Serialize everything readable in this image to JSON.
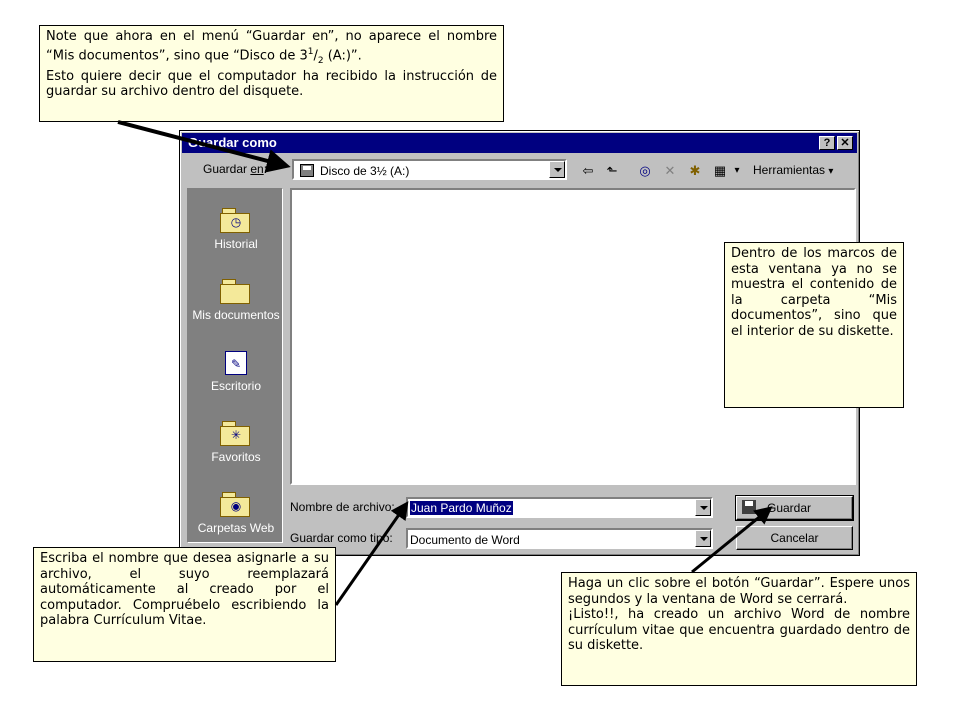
{
  "dialog": {
    "title": "Guardar como",
    "help_button": "?",
    "close_button": "✕",
    "save_in_label_prefix": "Guardar ",
    "save_in_label_accel": "en",
    "save_in_label_suffix": ":",
    "save_in_value": "Disco de 3½ (A:)",
    "toolbar": {
      "back": "⇦",
      "up_folder": "⬑",
      "search_web": "◎",
      "delete": "✕",
      "new_folder": "✱",
      "views": "▦",
      "views_dropdown": "▾",
      "tools_label": "Herramientas",
      "tools_dropdown": "▾"
    },
    "places": [
      {
        "label": "Historial",
        "icon": "history-icon",
        "symbol": "◷"
      },
      {
        "label": "Mis documentos",
        "icon": "my-documents-icon",
        "symbol": ""
      },
      {
        "label": "Escritorio",
        "icon": "desktop-icon",
        "symbol": "✎"
      },
      {
        "label": "Favoritos",
        "icon": "favorites-icon",
        "symbol": "✳"
      },
      {
        "label": "Carpetas Web",
        "icon": "web-folders-icon",
        "symbol": "◉"
      }
    ],
    "filename_label": "Nombre de archivo:",
    "filename_value": "Juan Pardo Muñoz",
    "filetype_label": "Guardar como tipo:",
    "filetype_value": "Documento de Word",
    "save_button": "Guardar",
    "cancel_button": "Cancelar"
  },
  "callouts": {
    "top": {
      "line1": "Note que ahora en el menú “Guardar en”, no aparece el nombre “Mis documentos”, sino que “Disco de 3",
      "frac_num": "1",
      "frac_sep": "/",
      "frac_den": "2",
      "line1_end": " (A:)”.",
      "line2": "Esto quiere decir que el computador ha recibido la instrucción de guardar su archivo dentro del disquete."
    },
    "right": "Dentro de los marcos de esta ventana ya no se muestra el contenido de la carpeta “Mis documentos”, sino que el interior de su diskette.",
    "bottom_left": "Escriba el nombre que desea asignarle a su archivo, el suyo reemplazará automáticamente al creado por el computador. Compruébelo escribiendo la palabra Currículum Vitae.",
    "bottom_right_1": "Haga un clic sobre el botón “Guardar”. Espere unos segundos y la ventana de Word se cerrará.",
    "bottom_right_2": "¡Listo!!, ha creado un archivo Word de nombre currículum vitae que encuentra guardado dentro de su diskette."
  },
  "colors": {
    "titlebar": "#000080",
    "dialog_face": "#c0c0c0",
    "callout_bg": "#ffffe1",
    "selection": "#000080"
  }
}
